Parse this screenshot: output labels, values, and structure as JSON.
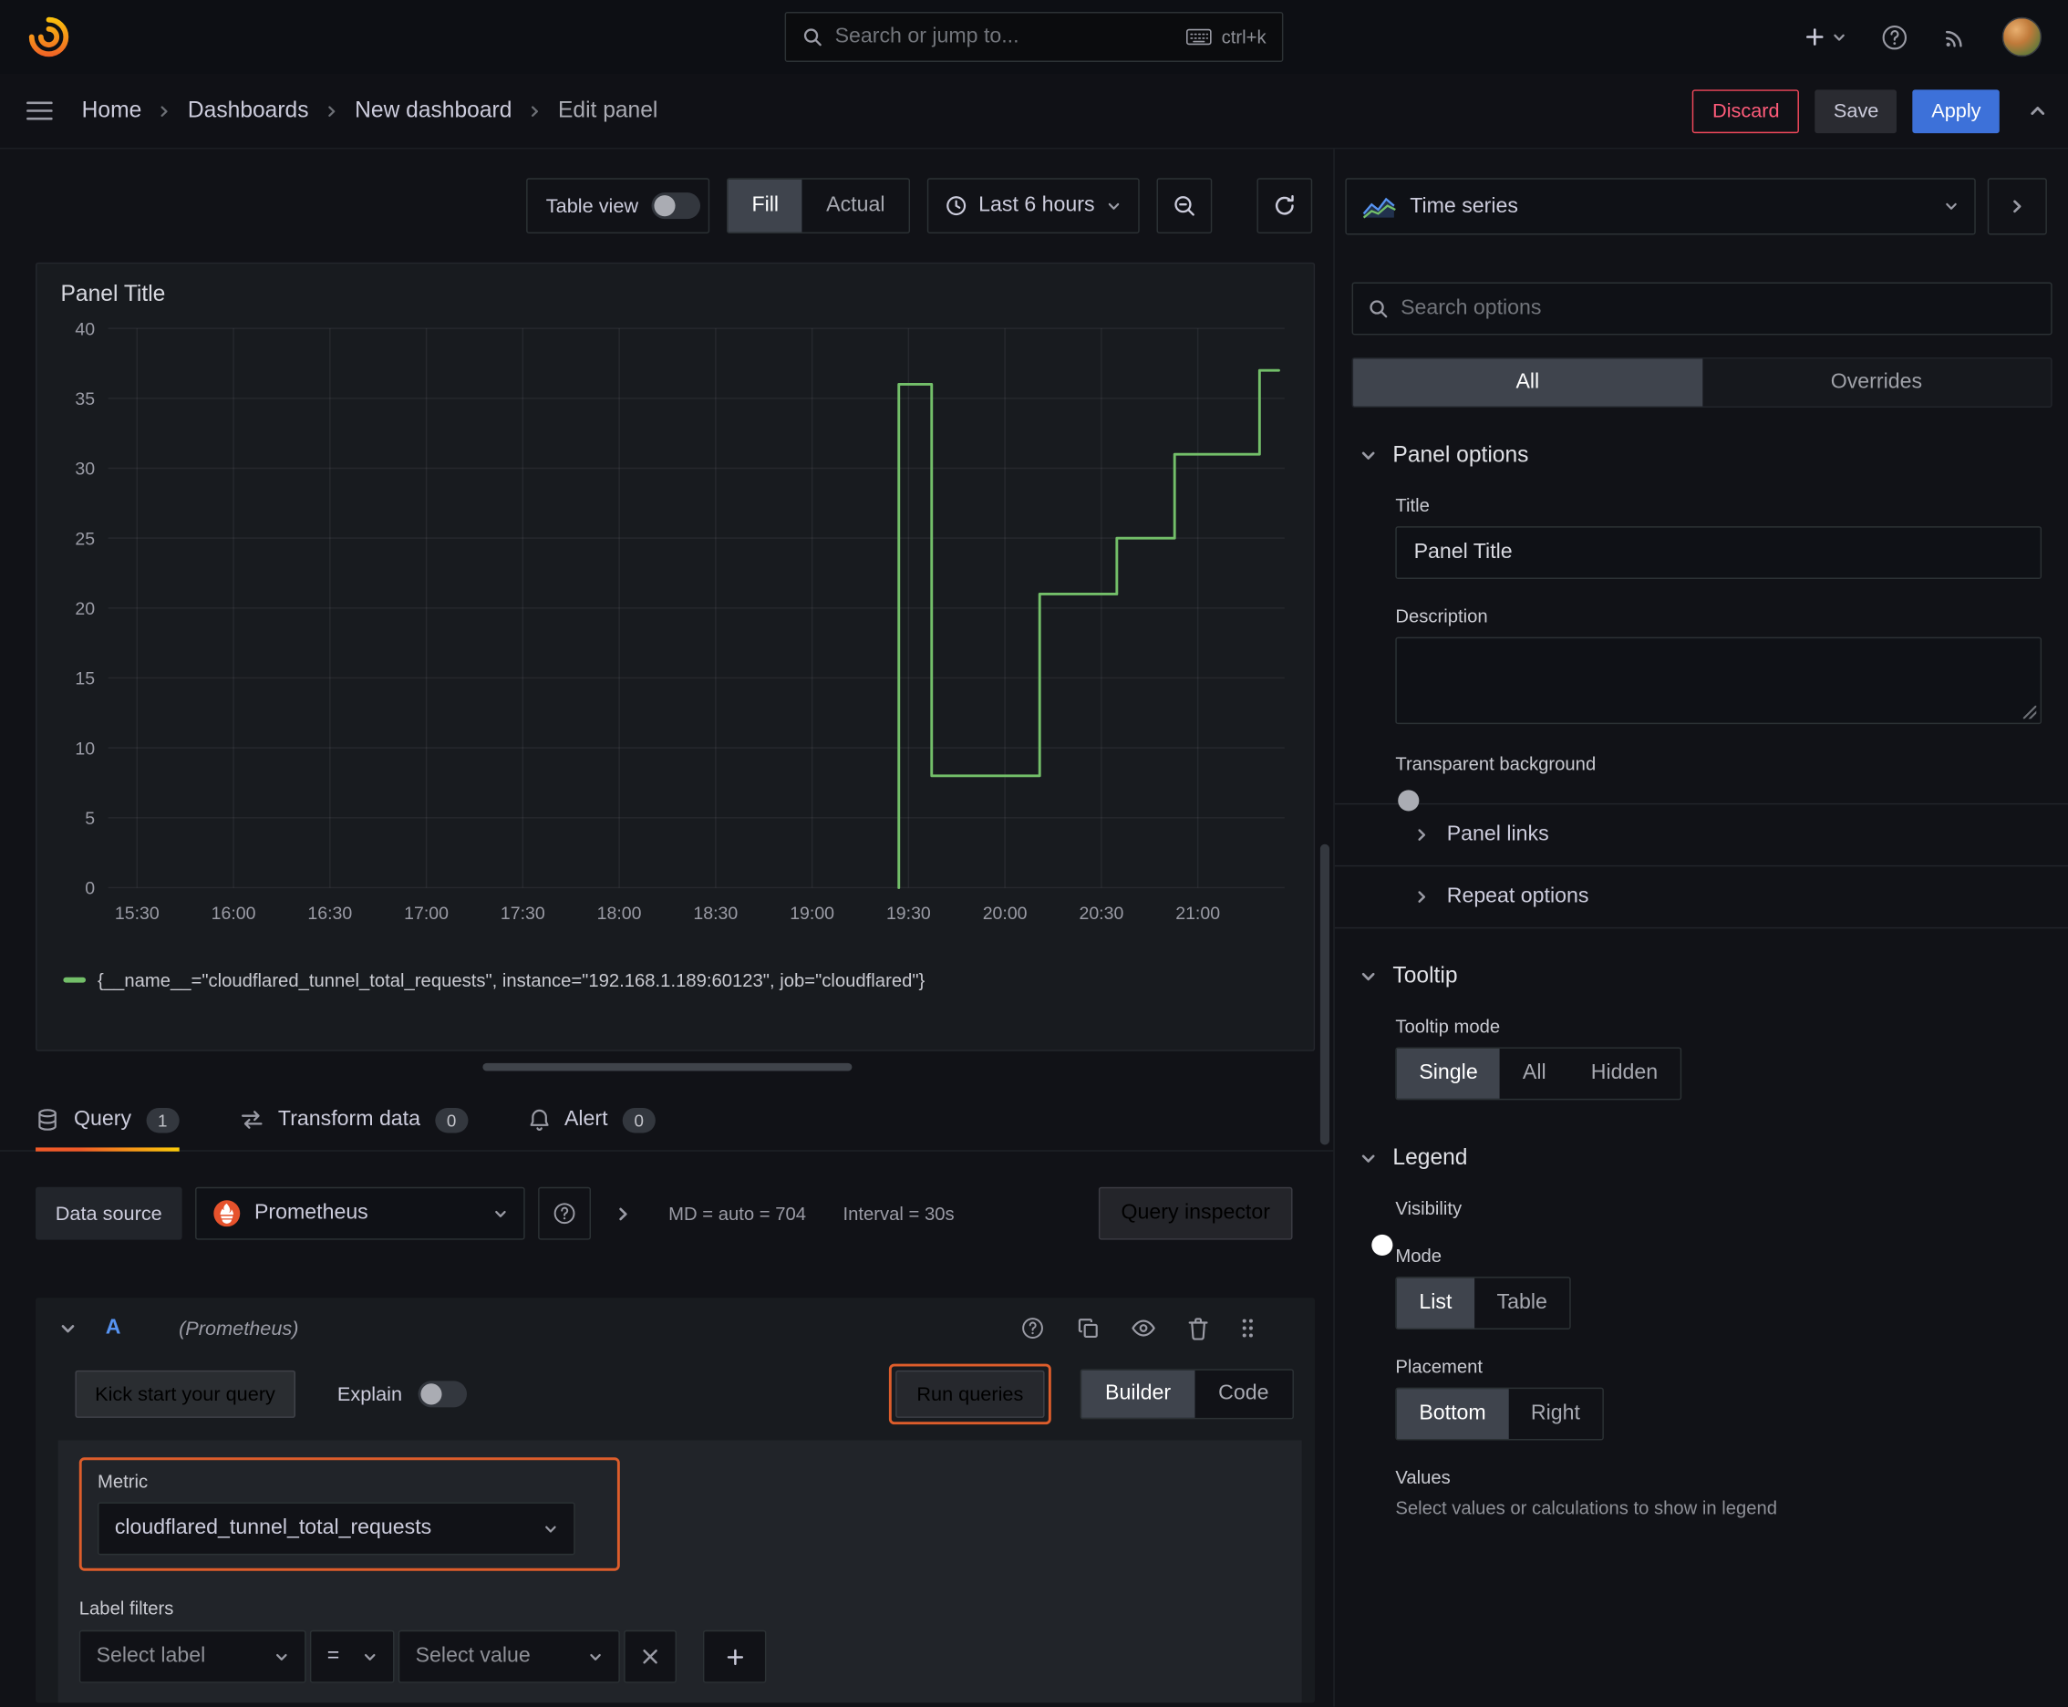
{
  "topnav": {
    "search_placeholder": "Search or jump to...",
    "search_shortcut": "ctrl+k"
  },
  "breadcrumb": {
    "items": [
      "Home",
      "Dashboards",
      "New dashboard",
      "Edit panel"
    ]
  },
  "header_actions": {
    "discard": "Discard",
    "save": "Save",
    "apply": "Apply"
  },
  "toolbar": {
    "table_view": "Table view",
    "fill": "Fill",
    "actual": "Actual",
    "time_range": "Last 6 hours"
  },
  "panel": {
    "title": "Panel Title"
  },
  "chart_data": {
    "type": "line",
    "step": true,
    "title": "Panel Title",
    "xlabel": "",
    "ylabel": "",
    "x_range": [
      15.35,
      21.45
    ],
    "y_range": [
      0,
      40
    ],
    "y_ticks": [
      0,
      5,
      10,
      15,
      20,
      25,
      30,
      35,
      40
    ],
    "x_ticks": [
      {
        "h": 15.5,
        "label": "15:30"
      },
      {
        "h": 16.0,
        "label": "16:00"
      },
      {
        "h": 16.5,
        "label": "16:30"
      },
      {
        "h": 17.0,
        "label": "17:00"
      },
      {
        "h": 17.5,
        "label": "17:30"
      },
      {
        "h": 18.0,
        "label": "18:00"
      },
      {
        "h": 18.5,
        "label": "18:30"
      },
      {
        "h": 19.0,
        "label": "19:00"
      },
      {
        "h": 19.5,
        "label": "19:30"
      },
      {
        "h": 20.0,
        "label": "20:00"
      },
      {
        "h": 20.5,
        "label": "20:30"
      },
      {
        "h": 21.0,
        "label": "21:00"
      }
    ],
    "grid": true,
    "legend_position": "bottom",
    "series": [
      {
        "name": "{__name__=\"cloudflared_tunnel_total_requests\", instance=\"192.168.1.189:60123\", job=\"cloudflared\"}",
        "color": "#73bf69",
        "points": [
          [
            19.45,
            0
          ],
          [
            19.45,
            36
          ],
          [
            19.62,
            36
          ],
          [
            19.62,
            8
          ],
          [
            20.18,
            8
          ],
          [
            20.18,
            21
          ],
          [
            20.58,
            21
          ],
          [
            20.58,
            25
          ],
          [
            20.88,
            25
          ],
          [
            20.88,
            31
          ],
          [
            21.32,
            31
          ],
          [
            21.32,
            37
          ],
          [
            21.42,
            37
          ]
        ]
      }
    ]
  },
  "editor_tabs": {
    "query": "Query",
    "query_count": "1",
    "transform": "Transform data",
    "transform_count": "0",
    "alert": "Alert",
    "alert_count": "0"
  },
  "datasource": {
    "label": "Data source",
    "name": "Prometheus",
    "max_data_points": "MD = auto = 704",
    "interval": "Interval = 30s",
    "inspector": "Query inspector"
  },
  "query": {
    "ref_id": "A",
    "ds_name": "(Prometheus)",
    "kick_start": "Kick start your query",
    "explain": "Explain",
    "run_queries": "Run queries",
    "builder": "Builder",
    "code": "Code",
    "metric_label": "Metric",
    "metric_value": "cloudflared_tunnel_total_requests",
    "label_filters": "Label filters",
    "select_label": "Select label",
    "operator": "=",
    "select_value": "Select value"
  },
  "sidebar": {
    "viz_name": "Time series",
    "search_placeholder": "Search options",
    "tab_all": "All",
    "tab_overrides": "Overrides",
    "panel_options": {
      "heading": "Panel options",
      "title_label": "Title",
      "title_value": "Panel Title",
      "description_label": "Description",
      "transparent_label": "Transparent background",
      "links": "Panel links",
      "repeat": "Repeat options"
    },
    "tooltip": {
      "heading": "Tooltip",
      "mode_label": "Tooltip mode",
      "options": [
        "Single",
        "All",
        "Hidden"
      ],
      "selected": "Single"
    },
    "legend": {
      "heading": "Legend",
      "visibility_label": "Visibility",
      "mode_label": "Mode",
      "mode_options": [
        "List",
        "Table"
      ],
      "mode_selected": "List",
      "placement_label": "Placement",
      "placement_options": [
        "Bottom",
        "Right"
      ],
      "placement_selected": "Bottom",
      "values_label": "Values",
      "values_help": "Select values or calculations to show in legend"
    }
  }
}
